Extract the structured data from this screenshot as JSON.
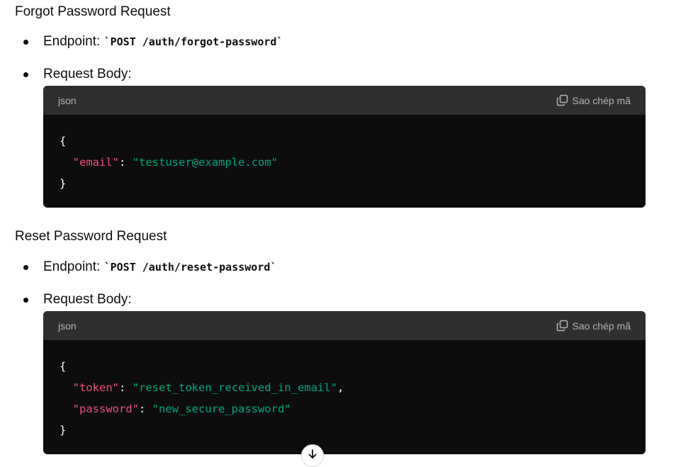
{
  "sections": [
    {
      "title": "Forgot Password Request",
      "endpoint_label": "Endpoint:",
      "endpoint_code": "`POST /auth/forgot-password`",
      "body_label": "Request Body:",
      "code": {
        "language": "json",
        "copy_label": "Sao chép mã",
        "open_brace": "{",
        "close_brace": "}",
        "lines": [
          {
            "key": "\"email\"",
            "sep": ": ",
            "value": "\"testuser@example.com\"",
            "trail": ""
          }
        ]
      }
    },
    {
      "title": "Reset Password Request",
      "endpoint_label": "Endpoint:",
      "endpoint_code": "`POST /auth/reset-password`",
      "body_label": "Request Body:",
      "code": {
        "language": "json",
        "copy_label": "Sao chép mã",
        "open_brace": "{",
        "close_brace": "}",
        "lines": [
          {
            "key": "\"token\"",
            "sep": ": ",
            "value": "\"reset_token_received_in_email\"",
            "trail": ","
          },
          {
            "key": "\"password\"",
            "sep": ": ",
            "value": "\"new_secure_password\"",
            "trail": ""
          }
        ]
      }
    }
  ],
  "icons": {
    "copy": "copy-icon",
    "scroll_down": "arrow-down-icon"
  },
  "colors": {
    "code_bg": "#0d0d0d",
    "code_header_bg": "#2f2f2f",
    "json_key": "#ef4f7d",
    "json_string": "#00a67d"
  }
}
